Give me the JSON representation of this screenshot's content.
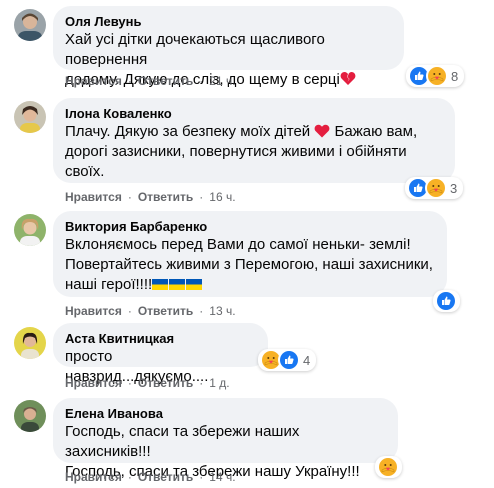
{
  "colors": {
    "bubble_bg": "#f0f2f5",
    "meta_text": "#65676b",
    "like_blue": "#1877f2",
    "care_yellow": "#f7b125",
    "heart_red": "#e41e3f",
    "flag_blue": "#0057b7",
    "flag_yellow": "#ffd700"
  },
  "labels": {
    "like": "Нравится",
    "reply": "Ответить",
    "separator": "·"
  },
  "comments": [
    {
      "author": "Оля Левунь",
      "text_lines": [
        "Хай усі дітки дочекаються щасливого повернення",
        "додому. Дякую до сліз, до щему в серці"
      ],
      "trailing_icon": "broken-heart-icon",
      "time": "21 ч.",
      "reaction_icons": [
        "like-icon",
        "care-icon"
      ],
      "reaction_count": "8"
    },
    {
      "author": "Ілона Коваленко",
      "text_lines": [
        "Плачу. Дякую за безпеку моїх дітей",
        "дорогі зазисники, повернутися живими і обійняти",
        "своїх."
      ],
      "inline_icon": "red-heart-icon",
      "inline_after": "Бажаю вам,",
      "time": "16 ч.",
      "reaction_icons": [
        "like-icon",
        "care-icon"
      ],
      "reaction_count": "3"
    },
    {
      "author": "Виктория Барбаренко",
      "text_lines": [
        "Вклоняємось перед Вами до самої неньки- землі!",
        "Повертайтесь живими з Перемогою, наші захисники,",
        "наші герої!!!!"
      ],
      "flags": [
        "ukraine-flag-icon",
        "ukraine-flag-icon",
        "ukraine-flag-icon"
      ],
      "time": "13 ч.",
      "reaction_icons": [
        "like-icon"
      ],
      "reaction_count": ""
    },
    {
      "author": "Аста Квитницкая",
      "text_lines": [
        "просто навзрид...дякуємо...."
      ],
      "time": "1 д.",
      "reaction_icons": [
        "care-icon",
        "like-icon"
      ],
      "reaction_count": "4"
    },
    {
      "author": "Елена Иванова",
      "text_lines": [
        "Господь, спаси та збережи наших захисників!!!",
        "Господь, спаси та збережи нашу Україну!!!"
      ],
      "time": "14 ч.",
      "reaction_icons": [
        "care-icon"
      ],
      "reaction_count": ""
    }
  ]
}
